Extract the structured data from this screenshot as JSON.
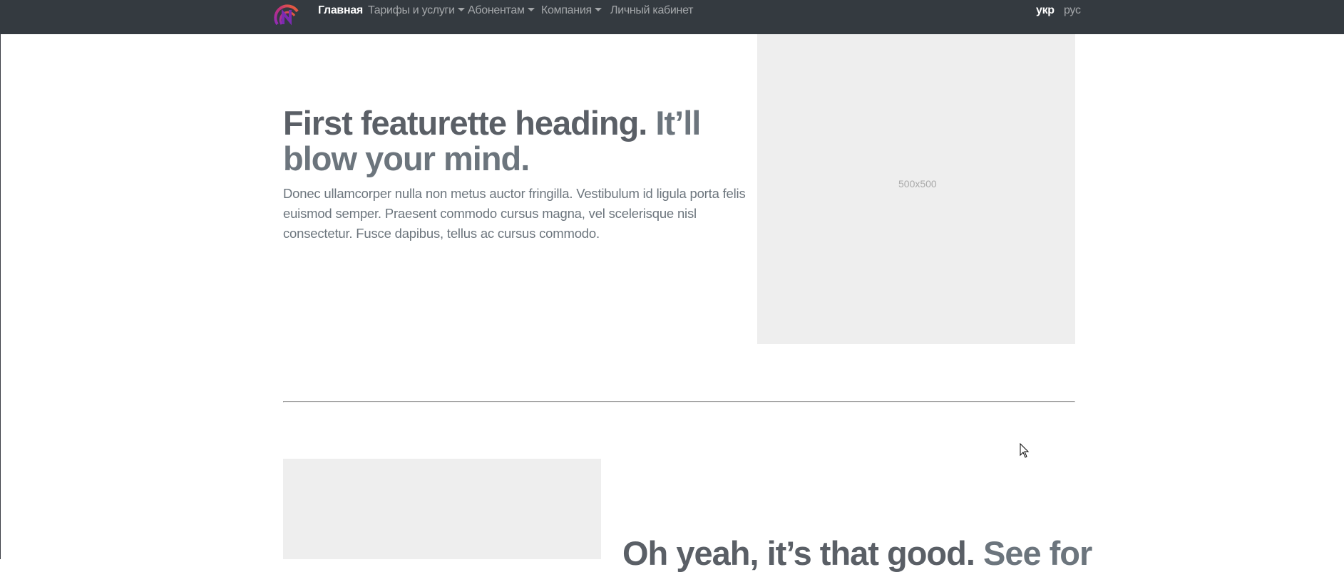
{
  "navbar": {
    "brand_icon": "network-logo-icon",
    "items": [
      {
        "label": "Главная",
        "active": true,
        "dropdown": false
      },
      {
        "label": "Тарифы и услуги",
        "active": false,
        "dropdown": true
      },
      {
        "label": "Абонентам",
        "active": false,
        "dropdown": true
      },
      {
        "label": "Компания",
        "active": false,
        "dropdown": true
      },
      {
        "label": "Личный кабинет",
        "active": false,
        "dropdown": false
      }
    ],
    "languages": [
      {
        "label": "укр",
        "active": true
      },
      {
        "label": "рус",
        "active": false
      }
    ]
  },
  "featurette_1": {
    "heading": "First featurette heading.",
    "heading_muted": "It’ll blow your mind.",
    "lead": "Donec ullamcorper nulla non metus auctor fringilla. Vestibulum id ligula porta felis euismod semper. Praesent commodo cursus magna, vel scelerisque nisl consectetur. Fusce dapibus, tellus ac cursus commodo.",
    "image_label": "500x500"
  },
  "featurette_2": {
    "heading": "Oh yeah, it’s that good.",
    "heading_muted": "See for"
  },
  "colors": {
    "navbar_bg": "#343a40",
    "placeholder_bg": "#eeeeee",
    "text_muted": "#6c757d"
  }
}
